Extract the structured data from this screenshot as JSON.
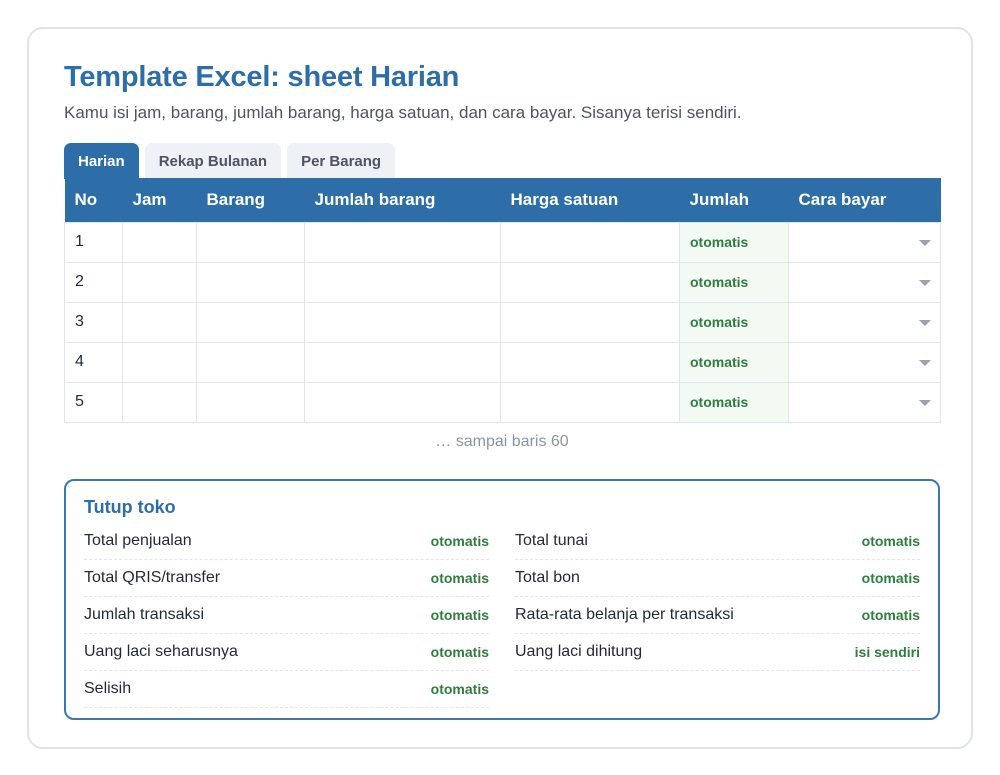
{
  "page": {
    "title": "Template Excel: sheet Harian",
    "subtitle": "Kamu isi jam, barang, jumlah barang, harga satuan, dan cara bayar. Sisanya terisi sendiri."
  },
  "tabs": [
    {
      "label": "Harian",
      "active": true
    },
    {
      "label": "Rekap Bulanan",
      "active": false
    },
    {
      "label": "Per Barang",
      "active": false
    }
  ],
  "table": {
    "headers": [
      "No",
      "Jam",
      "Barang",
      "Jumlah barang",
      "Harga satuan",
      "Jumlah",
      "Cara bayar"
    ],
    "rows": [
      {
        "no": "1",
        "jumlah": "otomatis"
      },
      {
        "no": "2",
        "jumlah": "otomatis"
      },
      {
        "no": "3",
        "jumlah": "otomatis"
      },
      {
        "no": "4",
        "jumlah": "otomatis"
      },
      {
        "no": "5",
        "jumlah": "otomatis"
      }
    ],
    "more_note": "… sampai baris 60"
  },
  "summary": {
    "title": "Tutup toko",
    "left": [
      {
        "label": "Total penjualan",
        "value": "otomatis"
      },
      {
        "label": "Total QRIS/transfer",
        "value": "otomatis"
      },
      {
        "label": "Jumlah transaksi",
        "value": "otomatis"
      },
      {
        "label": "Uang laci seharusnya",
        "value": "otomatis"
      },
      {
        "label": "Selisih",
        "value": "otomatis"
      }
    ],
    "right": [
      {
        "label": "Total tunai",
        "value": "otomatis"
      },
      {
        "label": "Total bon",
        "value": "otomatis"
      },
      {
        "label": "Rata-rata belanja per transaksi",
        "value": "otomatis"
      },
      {
        "label": "Uang laci dihitung",
        "value": "isi sendiri"
      }
    ]
  },
  "colors": {
    "accent": "#2d6da8",
    "auto_text": "#2f7d3f",
    "auto_bg": "#f3faf4"
  }
}
